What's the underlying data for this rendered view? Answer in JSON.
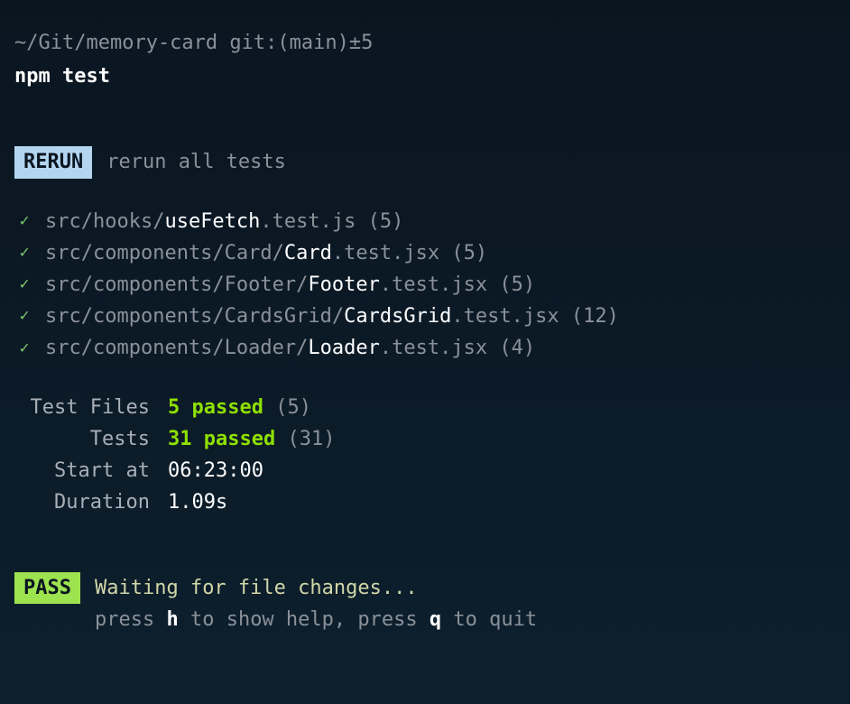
{
  "prompt": {
    "path": "~/Git/memory-card",
    "git_prefix": "git:(",
    "branch": "main",
    "git_suffix": ")±5"
  },
  "command": "npm test",
  "rerun": {
    "badge": "RERUN",
    "description": "rerun all tests"
  },
  "tests": [
    {
      "prefix": "src/hooks/",
      "name": "useFetch",
      "suffix": ".test.js",
      "count": "(5)"
    },
    {
      "prefix": "src/components/Card/",
      "name": "Card",
      "suffix": ".test.jsx",
      "count": "(5)"
    },
    {
      "prefix": "src/components/Footer/",
      "name": "Footer",
      "suffix": ".test.jsx",
      "count": "(5)"
    },
    {
      "prefix": "src/components/CardsGrid/",
      "name": "CardsGrid",
      "suffix": ".test.jsx",
      "count": "(12)"
    },
    {
      "prefix": "src/components/Loader/",
      "name": "Loader",
      "suffix": ".test.jsx",
      "count": "(4)"
    }
  ],
  "summary": {
    "test_files_label": "Test Files",
    "test_files_passed": "5 passed",
    "test_files_total": "(5)",
    "tests_label": "Tests",
    "tests_passed": "31 passed",
    "tests_total": "(31)",
    "start_label": "Start at",
    "start_value": "06:23:00",
    "duration_label": "Duration",
    "duration_value": "1.09s"
  },
  "footer": {
    "badge": "PASS",
    "waiting": "Waiting for file changes...",
    "help_prefix1": "press ",
    "help_key1": "h",
    "help_mid": " to show help, press ",
    "help_key2": "q",
    "help_suffix": " to quit"
  }
}
